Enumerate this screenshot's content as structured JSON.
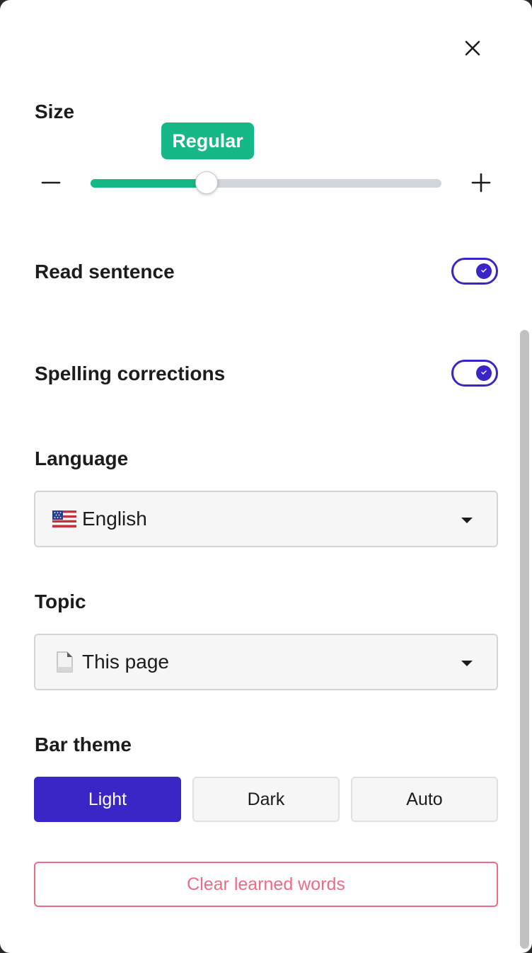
{
  "header": {
    "close_icon": "close-icon"
  },
  "size": {
    "label": "Size",
    "value_label": "Regular",
    "slider_value_percent": 33,
    "minus_icon": "minus-icon",
    "plus_icon": "plus-icon",
    "accent_color": "#15b886"
  },
  "read_sentence": {
    "label": "Read sentence",
    "enabled": true
  },
  "spelling_corrections": {
    "label": "Spelling corrections",
    "enabled": true
  },
  "language": {
    "label": "Language",
    "selected": "English",
    "icon": "us-flag-icon"
  },
  "topic": {
    "label": "Topic",
    "selected": "This page",
    "icon": "page-icon"
  },
  "bar_theme": {
    "label": "Bar theme",
    "options": [
      {
        "label": "Light",
        "active": true
      },
      {
        "label": "Dark",
        "active": false
      },
      {
        "label": "Auto",
        "active": false
      }
    ],
    "accent_color": "#3a25c7"
  },
  "clear_button": {
    "label": "Clear learned words",
    "color": "#f06a84"
  }
}
